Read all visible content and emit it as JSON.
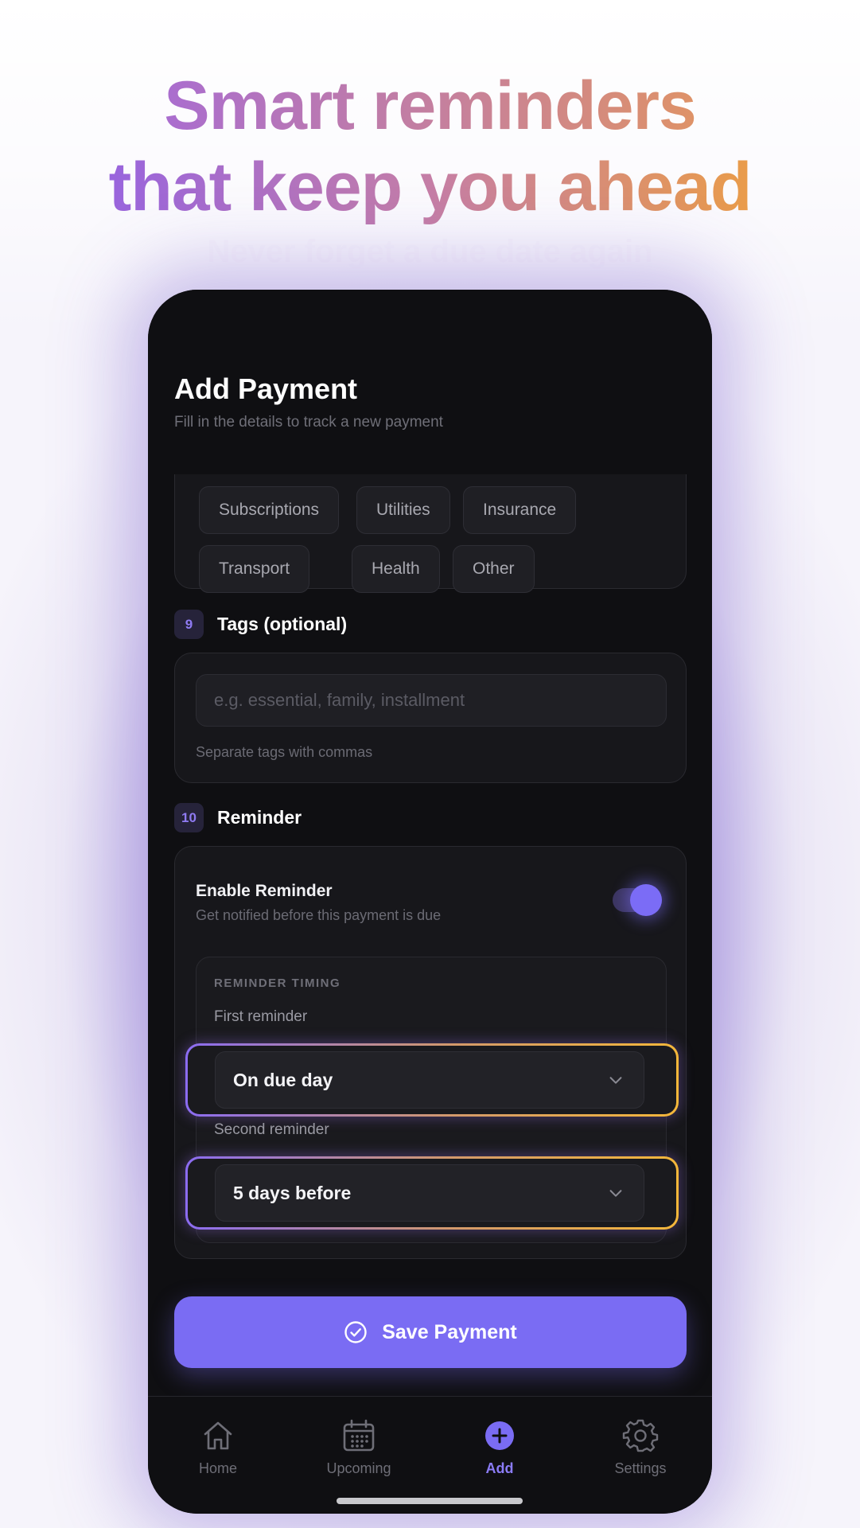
{
  "promo": {
    "headline_line1": "Smart reminders",
    "headline_line2": "that keep you ahead",
    "subheadline": "Never forget a due date again"
  },
  "screen": {
    "title": "Add Payment",
    "subtitle": "Fill in the details to track a new payment"
  },
  "categories": {
    "chips": [
      "Subscriptions",
      "Utilities",
      "Insurance",
      "Transport",
      "Health",
      "Other"
    ]
  },
  "tags_section": {
    "number": "9",
    "label": "Tags (optional)",
    "placeholder": "e.g. essential, family, installment",
    "helper": "Separate tags with commas"
  },
  "reminder_section": {
    "number": "10",
    "label": "Reminder",
    "enable_title": "Enable Reminder",
    "enable_desc": "Get notified before this payment is due",
    "enabled": true,
    "timing_label": "REMINDER TIMING",
    "first_label": "First reminder",
    "first_value": "On due day",
    "second_label": "Second reminder",
    "second_value": "5 days before"
  },
  "save_button": {
    "label": "Save Payment",
    "icon": "check-circle-icon"
  },
  "tabbar": {
    "items": [
      {
        "label": "Home",
        "icon": "home-icon"
      },
      {
        "label": "Upcoming",
        "icon": "calendar-icon"
      },
      {
        "label": "Add",
        "icon": "plus-circle-icon",
        "active": true
      },
      {
        "label": "Settings",
        "icon": "gear-icon"
      }
    ]
  },
  "colors": {
    "accent": "#7a6cf3",
    "gradient_start": "#8a5cf0",
    "gradient_end": "#f6a62a",
    "background_dark": "#0f0f12"
  }
}
